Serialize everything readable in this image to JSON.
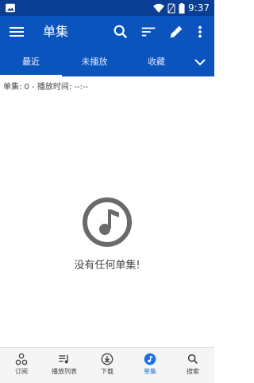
{
  "status_bar": {
    "time": "9:37",
    "battery_icon": "battery-icon",
    "wifi_icon": "wifi-icon",
    "no_sim_icon": "no-sim-icon",
    "gallery_icon": "image-icon"
  },
  "appbar": {
    "title": "单集",
    "menu_icon": "menu-icon",
    "search_icon": "search-icon",
    "filter_icon": "filter-icon",
    "edit_icon": "edit-icon",
    "more_icon": "more-vert-icon"
  },
  "tabs": [
    {
      "label": "最近",
      "active": true
    },
    {
      "label": "未播放",
      "active": false
    },
    {
      "label": "收藏",
      "active": false
    }
  ],
  "info_text": "单集: 0 - 播放时间: --:--",
  "empty_state": {
    "icon": "music-note-icon",
    "text": "没有任何单集!"
  },
  "bottom_nav": [
    {
      "label": "订阅",
      "icon": "subscriptions-icon",
      "active": false
    },
    {
      "label": "播放列表",
      "icon": "playlist-icon",
      "active": false
    },
    {
      "label": "下载",
      "icon": "download-icon",
      "active": false
    },
    {
      "label": "单集",
      "icon": "episodes-icon",
      "active": true
    },
    {
      "label": "搜索",
      "icon": "search-icon",
      "active": false
    }
  ],
  "colors": {
    "primary": "#0b53bd",
    "status_bar": "#0a3e94",
    "active_accent": "#1a73e8"
  }
}
